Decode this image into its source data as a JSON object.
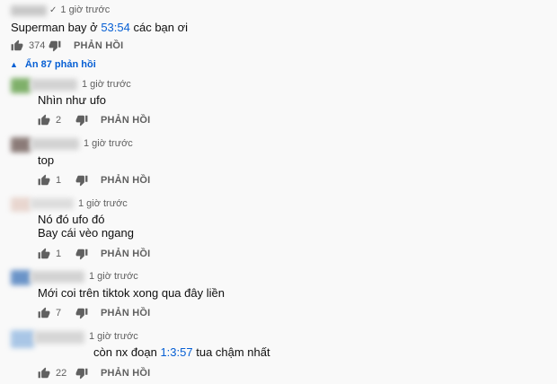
{
  "top_comment": {
    "time": "1 giờ trước",
    "text_before": "Superman bay ở ",
    "timestamp": "53:54",
    "text_after": " các bạn ơi",
    "likes": "374",
    "reply_label": "PHẢN HỒI"
  },
  "toggle": {
    "label": "Ẩn 87 phản hồi"
  },
  "replies": [
    {
      "time": "1 giờ trước",
      "lines": [
        "Nhìn như ufo"
      ],
      "likes": "2",
      "reply_label": "PHẢN HỒI",
      "avatar_color": "#7fb06a"
    },
    {
      "time": "1 giờ trước",
      "lines": [
        "top"
      ],
      "likes": "1",
      "reply_label": "PHẢN HỒI",
      "avatar_color": "#8b7b78"
    },
    {
      "time": "1 giờ trước",
      "lines": [
        "Nó đó ufo đó",
        "Bay cái vèo ngang"
      ],
      "likes": "1",
      "reply_label": "PHẢN HỒI",
      "avatar_color": "#e8d6cf"
    },
    {
      "time": "1 giờ trước",
      "lines": [
        "Mới coi trên tiktok xong qua đây liền"
      ],
      "likes": "7",
      "reply_label": "PHẢN HỒI",
      "avatar_color": "#6b94c8"
    },
    {
      "time": "1 giờ trước",
      "text_before": "còn nx đoạn ",
      "timestamp": "1:3:57",
      "text_after": " tua chậm nhất",
      "likes": "22",
      "reply_label": "PHẢN HỒI",
      "avatar_color": "#a9c6e6"
    }
  ]
}
